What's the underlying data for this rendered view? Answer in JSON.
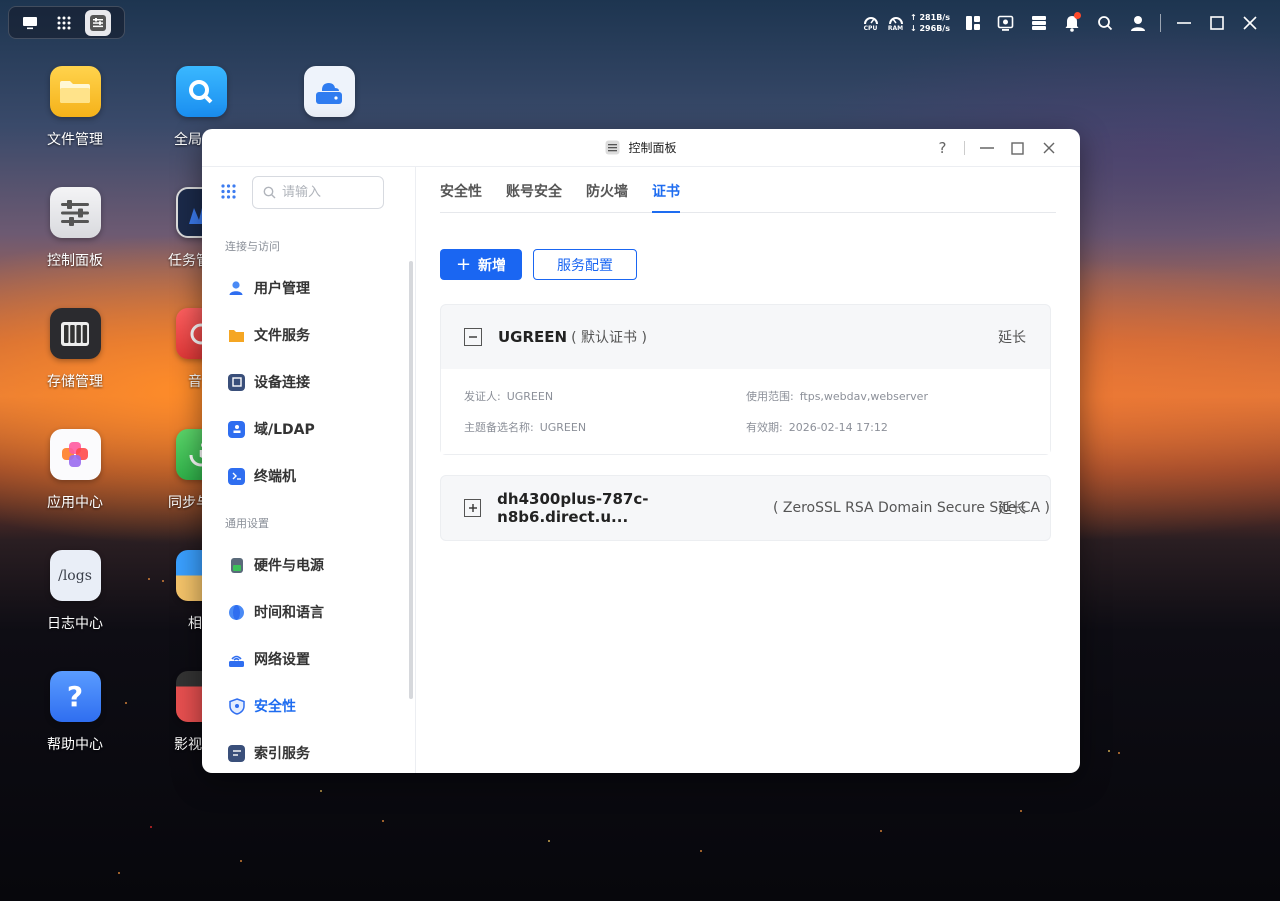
{
  "topbar": {
    "cpu_label": "CPU",
    "ram_label": "RAM",
    "upload": "↑ 281B/s",
    "download": "↓ 296B/s"
  },
  "desktop": [
    {
      "label": "文件管理",
      "icon": "folder-icon"
    },
    {
      "label": "全局",
      "icon": "search-app-icon"
    },
    {
      "label": "",
      "icon": "cloud-drive-icon"
    },
    {
      "label": "控制面板",
      "icon": "control-panel-icon"
    },
    {
      "label": "任务管",
      "icon": "task-manager-icon"
    },
    {
      "label": "存储管理",
      "icon": "storage-icon"
    },
    {
      "label": "音",
      "icon": "music-icon"
    },
    {
      "label": "应用中心",
      "icon": "app-center-icon"
    },
    {
      "label": "同步与",
      "icon": "sync-icon"
    },
    {
      "label": "日志中心",
      "icon": "logs-icon",
      "tile_text": "/logs"
    },
    {
      "label": "相",
      "icon": "photos-icon"
    },
    {
      "label": "帮助中心",
      "icon": "help-icon",
      "tile_text": "?"
    },
    {
      "label": "影视",
      "icon": "video-icon"
    }
  ],
  "window": {
    "title": "控制面板",
    "help": "?"
  },
  "sidebar": {
    "search_placeholder": "请输入",
    "section1": "连接与访问",
    "section2": "通用设置",
    "items": [
      {
        "label": "用户管理",
        "icon": "user-icon"
      },
      {
        "label": "文件服务",
        "icon": "folder-icon"
      },
      {
        "label": "设备连接",
        "icon": "device-icon"
      },
      {
        "label": "域/LDAP",
        "icon": "ldap-icon"
      },
      {
        "label": "终端机",
        "icon": "terminal-icon"
      },
      {
        "label": "硬件与电源",
        "icon": "hardware-icon"
      },
      {
        "label": "时间和语言",
        "icon": "globe-icon"
      },
      {
        "label": "网络设置",
        "icon": "network-icon"
      },
      {
        "label": "安全性",
        "icon": "shield-icon"
      },
      {
        "label": "索引服务",
        "icon": "index-icon"
      }
    ]
  },
  "tabs": [
    "安全性",
    "账号安全",
    "防火墙",
    "证书"
  ],
  "actions": {
    "add": "新增",
    "config": "服务配置"
  },
  "certs": [
    {
      "name": "UGREEN",
      "sub": "( 默认证书 )",
      "renew": "延长",
      "issuer_label": "发证人:",
      "issuer": "UGREEN",
      "scope_label": "使用范围:",
      "scope": "ftps,webdav,webserver",
      "alt_label": "主题备选名称:",
      "alt": "UGREEN",
      "valid_label": "有效期:",
      "valid": "2026-02-14 17:12"
    },
    {
      "name": "dh4300plus-787c-n8b6.direct.u...",
      "sub": "( ZeroSSL RSA Domain Secure Site CA )",
      "renew": "延长"
    }
  ]
}
